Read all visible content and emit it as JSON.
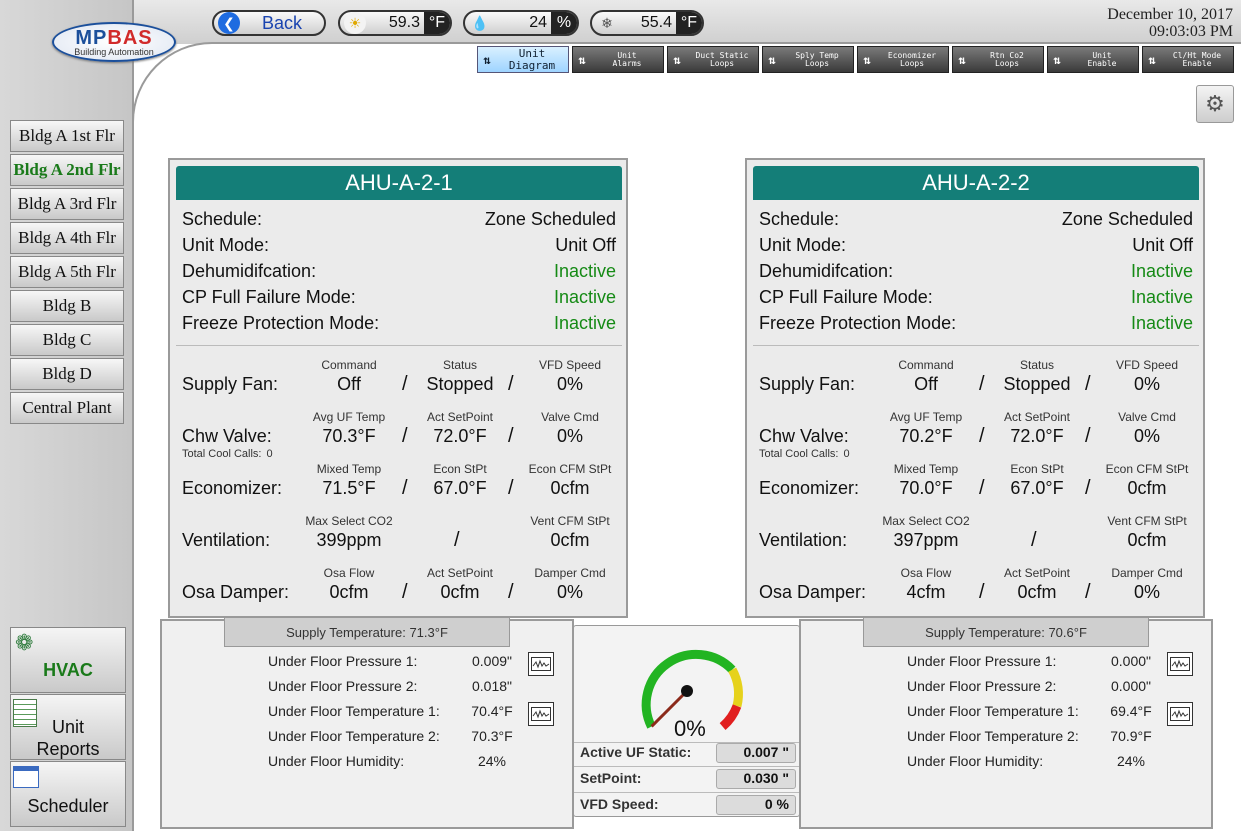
{
  "logo": {
    "brand_main": "MP",
    "brand_accent": "BAS",
    "tagline": "Building Automation"
  },
  "header": {
    "back_label": "Back",
    "outdoor_temp": "59.3",
    "outdoor_temp_unit": "°F",
    "humidity": "24",
    "humidity_unit": "%",
    "dewpoint": "55.4",
    "dewpoint_unit": "°F",
    "date": "December 10, 2017",
    "time": "09:03:03 PM"
  },
  "tabs": [
    {
      "line1": "Unit",
      "line2": "Diagram",
      "active": true
    },
    {
      "line1": "Unit",
      "line2": "Alarms"
    },
    {
      "line1": "Duct Static",
      "line2": "Loops"
    },
    {
      "line1": "Sply Temp",
      "line2": "Loops"
    },
    {
      "line1": "Economizer",
      "line2": "Loops"
    },
    {
      "line1": "Rtn Co2",
      "line2": "Loops"
    },
    {
      "line1": "Unit",
      "line2": "Enable"
    },
    {
      "line1": "Cl/Ht Mode",
      "line2": "Enable"
    }
  ],
  "nav": [
    "Bldg A 1st Flr",
    "Bldg A 2nd Flr",
    "Bldg A 3rd Flr",
    "Bldg A 4th Flr",
    "Bldg A 5th Flr",
    "Bldg B",
    "Bldg C",
    "Bldg D",
    "Central Plant"
  ],
  "side_buttons": {
    "hvac": "HVAC",
    "unit_reports_1": "Unit",
    "unit_reports_2": "Reports",
    "scheduler": "Scheduler"
  },
  "labels": {
    "schedule": "Schedule:",
    "unit_mode": "Unit Mode:",
    "dehum": "Dehumidifcation:",
    "cp_fail": "CP Full Failure Mode:",
    "freeze": "Freeze Protection Mode:",
    "supply_fan": "Supply Fan:",
    "command": "Command",
    "status": "Status",
    "vfd_speed": "VFD Speed",
    "chw_valve": "Chw Valve:",
    "avg_uf_temp": "Avg UF Temp",
    "act_setpoint": "Act SetPoint",
    "valve_cmd": "Valve Cmd",
    "total_cool_calls": "Total Cool Calls:",
    "economizer": "Economizer:",
    "mixed_temp": "Mixed Temp",
    "econ_stpt": "Econ StPt",
    "econ_cfm_stpt": "Econ CFM StPt",
    "ventilation": "Ventilation:",
    "max_select_co2": "Max Select CO2",
    "vent_cfm_stpt": "Vent CFM StPt",
    "osa_damper": "Osa Damper:",
    "osa_flow": "Osa Flow",
    "damper_cmd": "Damper Cmd",
    "slash": "/",
    "uf_pressure_1": "Under Floor Pressure 1:",
    "uf_pressure_2": "Under Floor Pressure 2:",
    "uf_temp_1": "Under Floor Temperature 1:",
    "uf_temp_2": "Under Floor Temperature 2:",
    "uf_humidity": "Under Floor Humidity:",
    "active_uf_static": "Active UF Static:",
    "setpoint": "SetPoint:",
    "vfd_speed_g": "VFD Speed:"
  },
  "ahu": [
    {
      "name": "AHU-A-2-1",
      "schedule": "Zone Scheduled",
      "unit_mode": "Unit Off",
      "dehum": "Inactive",
      "cp_fail": "Inactive",
      "freeze": "Inactive",
      "fan_cmd": "Off",
      "fan_status": "Stopped",
      "fan_vfd": "0%",
      "avg_uf_temp": "70.3°F",
      "chw_setpoint": "72.0°F",
      "valve_cmd": "0%",
      "cool_calls": "0",
      "mixed_temp": "71.5°F",
      "econ_stpt": "67.0°F",
      "econ_cfm": "0cfm",
      "co2": "399ppm",
      "vent_cfm": "0cfm",
      "osa_flow": "0cfm",
      "osa_setpoint": "0cfm",
      "damper_cmd": "0%",
      "supply_temp": "Supply Temperature: 71.3°F",
      "uf_p1": "0.009\"",
      "uf_p2": "0.018\"",
      "uf_t1": "70.4°F",
      "uf_t2": "70.3°F",
      "uf_h": "24%"
    },
    {
      "name": "AHU-A-2-2",
      "schedule": "Zone Scheduled",
      "unit_mode": "Unit Off",
      "dehum": "Inactive",
      "cp_fail": "Inactive",
      "freeze": "Inactive",
      "fan_cmd": "Off",
      "fan_status": "Stopped",
      "fan_vfd": "0%",
      "avg_uf_temp": "70.2°F",
      "chw_setpoint": "72.0°F",
      "valve_cmd": "0%",
      "cool_calls": "0",
      "mixed_temp": "70.0°F",
      "econ_stpt": "67.0°F",
      "econ_cfm": "0cfm",
      "co2": "397ppm",
      "vent_cfm": "0cfm",
      "osa_flow": "4cfm",
      "osa_setpoint": "0cfm",
      "damper_cmd": "0%",
      "supply_temp": "Supply Temperature: 70.6°F",
      "uf_p1": "0.000\"",
      "uf_p2": "0.000\"",
      "uf_t1": "69.4°F",
      "uf_t2": "70.9°F",
      "uf_h": "24%"
    }
  ],
  "gauge": {
    "percent_text": "0%",
    "value_percent": 0,
    "active_uf_static": "0.007 \"",
    "setpoint": "0.030 \"",
    "vfd_speed": "0 %"
  },
  "colors": {
    "header_teal": "#147e78",
    "status_green": "#158a15",
    "gauge_green": "#22b422",
    "gauge_yellow": "#e6d21c",
    "gauge_red": "#e11f1f"
  }
}
